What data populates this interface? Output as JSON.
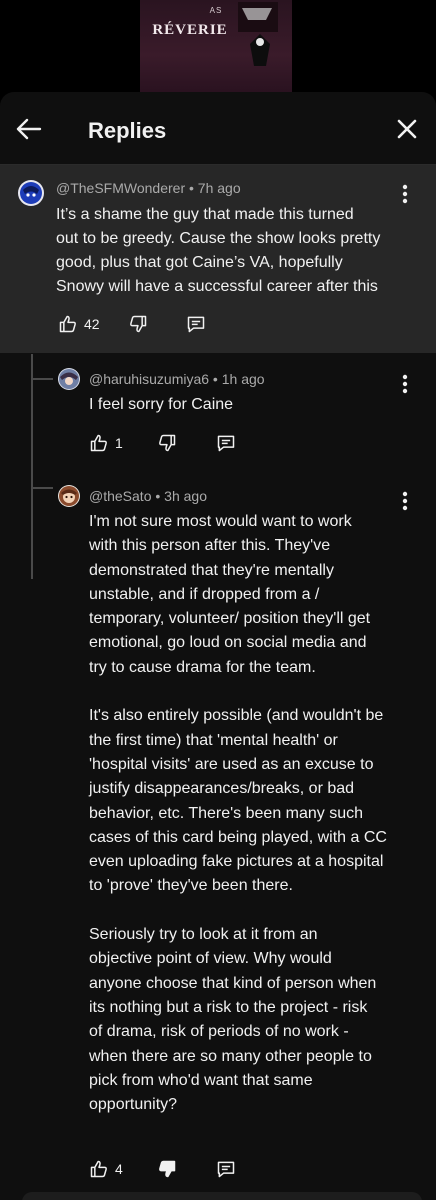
{
  "video": {
    "thumbnail_small_text": "AS",
    "thumbnail_title": "RÉVERIE"
  },
  "header": {
    "title": "Replies"
  },
  "comments": [
    {
      "author": "@TheSFMWonderer",
      "time": "7h ago",
      "lines": [
        "It’s a shame the guy that made this turned",
        "out to be greedy. Cause the show looks pretty",
        "good, plus that got Caine’s VA, hopefully",
        "Snowy will have a successful career after this"
      ],
      "likes": "42"
    },
    {
      "author": "@haruhisuzumiya6",
      "time": "1h ago",
      "lines": [
        "I feel sorry for Caine"
      ],
      "likes": "1"
    },
    {
      "author": "@theSato",
      "time": "3h ago",
      "lines": [
        "I'm not sure most would want to work",
        "with this person after this.  They've",
        "demonstrated that they're mentally",
        "unstable, and if dropped from a /",
        "temporary, volunteer/ position they'll get",
        "emotional, go loud on social media and",
        "try to cause drama for the team.",
        "",
        "It's also entirely possible (and wouldn't be",
        "the first time) that 'mental health' or",
        "'hospital visits' are used as an excuse to",
        "justify disappearances/breaks, or bad",
        "behavior, etc.  There's been many such",
        "cases of this card being played, with a CC",
        "even uploading fake pictures at a hospital",
        "to 'prove' they've been there.",
        "",
        "Seriously try to look at it from an",
        "objective point of view.  Why would",
        "anyone choose that kind of person when",
        "its nothing but a risk to the project - risk",
        "of drama, risk of periods of no work -",
        "when there are so many other people to",
        "pick from who'd want that same",
        "opportunity?"
      ],
      "likes": "4"
    }
  ],
  "colors": {
    "sheet_bg": "#0f0f0f",
    "highlight_bg": "#272727",
    "text": "#f1f1f1",
    "meta": "#aaaaaa"
  },
  "icons": [
    "back-arrow-icon",
    "close-icon",
    "more-vert-icon",
    "thumb-up-icon",
    "thumb-down-icon",
    "reply-icon"
  ]
}
